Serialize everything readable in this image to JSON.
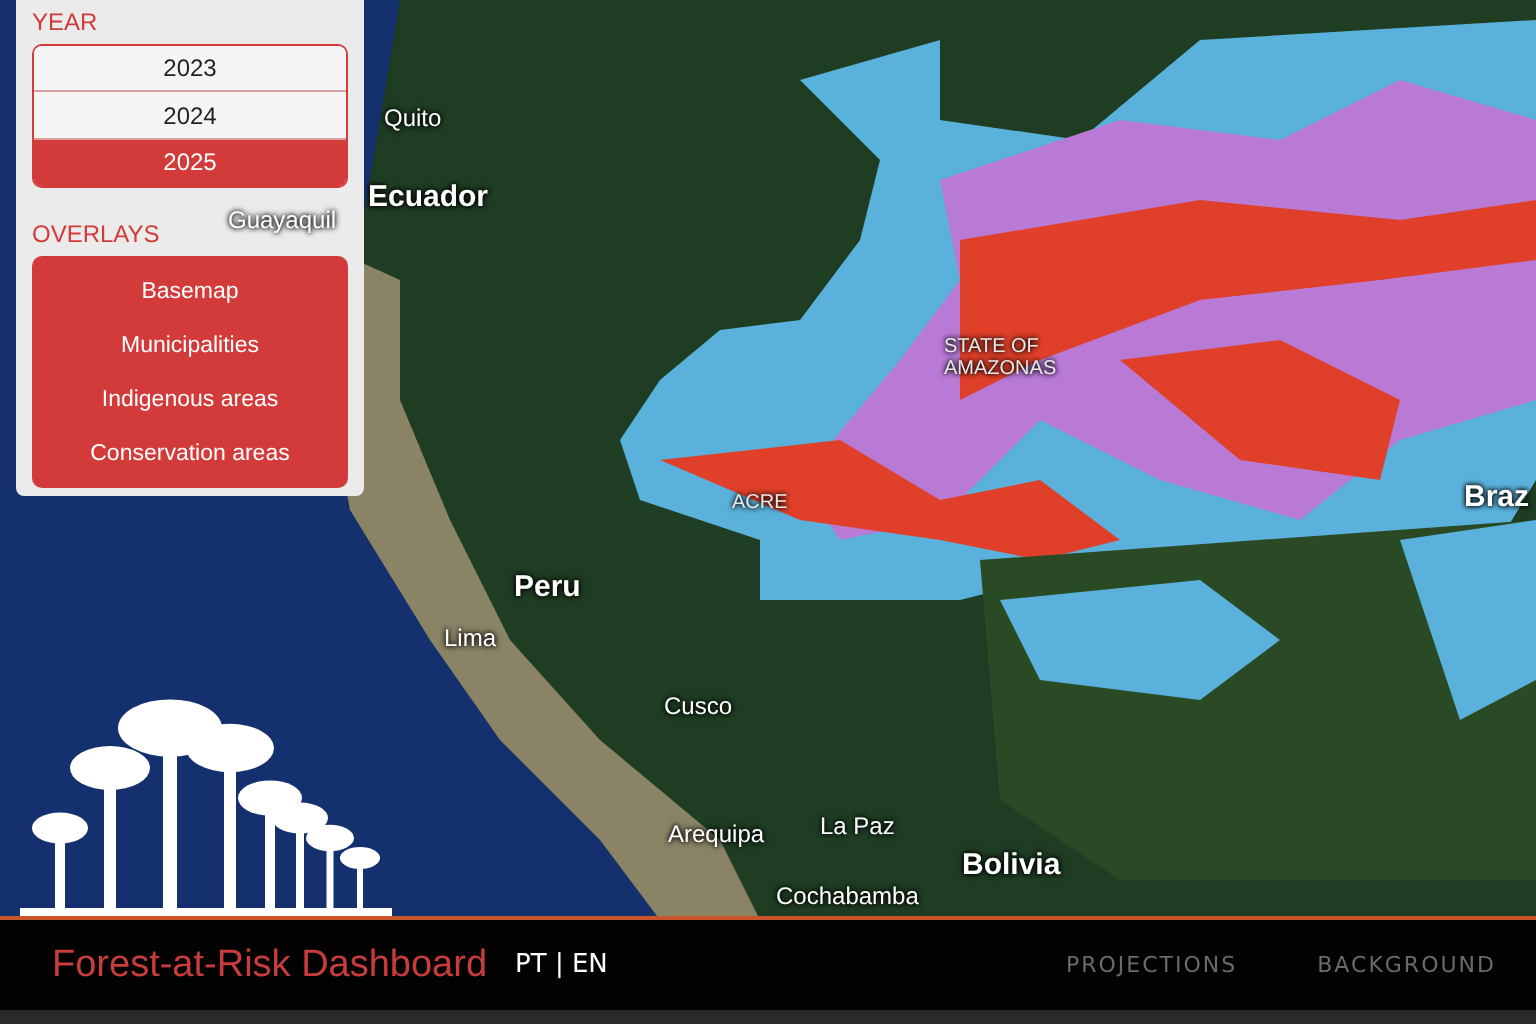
{
  "controls": {
    "year_heading": "YEAR",
    "years": [
      {
        "label": "2023",
        "selected": false
      },
      {
        "label": "2024",
        "selected": false
      },
      {
        "label": "2025",
        "selected": true
      }
    ],
    "overlays_heading": "OVERLAYS",
    "overlays": [
      "Basemap",
      "Municipalities",
      "Indigenous areas",
      "Conservation areas"
    ]
  },
  "map_labels": [
    {
      "text": "Quito",
      "kind": "city"
    },
    {
      "text": "Ecuador",
      "kind": "country"
    },
    {
      "text": "Guayaquil",
      "kind": "city"
    },
    {
      "text": "Peru",
      "kind": "country"
    },
    {
      "text": "Lima",
      "kind": "city"
    },
    {
      "text": "Cusco",
      "kind": "city"
    },
    {
      "text": "Arequipa",
      "kind": "city"
    },
    {
      "text": "La Paz",
      "kind": "city"
    },
    {
      "text": "Bolivia",
      "kind": "country"
    },
    {
      "text": "Cochabamba",
      "kind": "city"
    },
    {
      "text": "STATE OF AMAZONAS",
      "kind": "state"
    },
    {
      "text": "ACRE",
      "kind": "state"
    },
    {
      "text": "Braz",
      "kind": "country"
    }
  ],
  "footer": {
    "title": "Forest-at-Risk Dashboard",
    "language": "PT | EN",
    "nav": [
      "PROJECTIONS",
      "BACKGROUND"
    ]
  }
}
